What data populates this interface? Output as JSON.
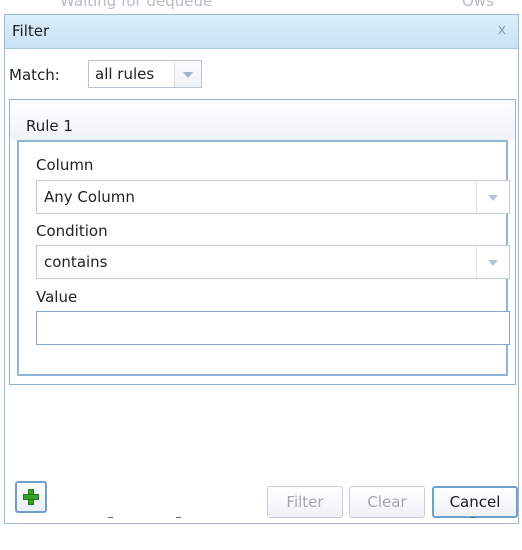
{
  "background": {
    "left_text": "Waiting for dequeue",
    "right_text": "Ows"
  },
  "dialog": {
    "title": "Filter",
    "close_glyph": "x",
    "match": {
      "label": "Match:",
      "selected": "all rules"
    },
    "rule": {
      "title": "Rule 1",
      "column_label": "Column",
      "column_value": "Any Column",
      "condition_label": "Condition",
      "condition_value": "contains",
      "value_label": "Value",
      "value_input": ""
    },
    "buttons": {
      "add_icon": "plus-icon",
      "filter": "Filter",
      "clear": "Clear",
      "cancel": "Cancel"
    }
  },
  "colors": {
    "titlebar": "#c9e3f5",
    "accent_border": "#6d9fcf",
    "add_icon": "#36a329",
    "disabled_text": "#a3a7ad"
  }
}
